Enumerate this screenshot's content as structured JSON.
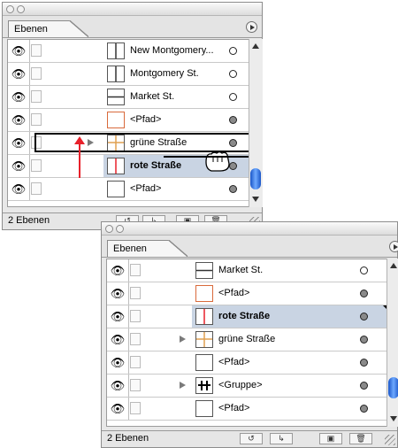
{
  "top_panel": {
    "tab_label": "Ebenen",
    "layers": [
      {
        "name": "New Montgomery...",
        "thumb": "vertical-line",
        "target": "empty",
        "selected": false
      },
      {
        "name": "Montgomery St.",
        "thumb": "vertical-line",
        "target": "empty",
        "selected": false
      },
      {
        "name": "Market St.",
        "thumb": "horizontal-line",
        "target": "empty",
        "selected": false
      },
      {
        "name": "<Pfad>",
        "thumb": "empty-box-orange",
        "target": "filled",
        "selected": false
      },
      {
        "name": "grüne Straße",
        "thumb": "cross-line",
        "target": "filled",
        "selected": false,
        "expandable": true
      },
      {
        "name": "rote Straße",
        "thumb": "red-vertical-line",
        "target": "filled",
        "selected": true
      },
      {
        "name": "<Pfad>",
        "thumb": "empty-box",
        "target": "filled",
        "selected": false
      }
    ],
    "footer": {
      "layer_count": "2 Ebenen"
    }
  },
  "bottom_panel": {
    "tab_label": "Ebenen",
    "layers": [
      {
        "name": "Market St.",
        "thumb": "horizontal-line",
        "target": "empty",
        "selected": false
      },
      {
        "name": "<Pfad>",
        "thumb": "empty-box-orange",
        "target": "filled",
        "selected": false
      },
      {
        "name": "rote Straße",
        "thumb": "red-vertical-line",
        "target": "filled",
        "selected": true
      },
      {
        "name": "grüne Straße",
        "thumb": "cross-line",
        "target": "filled",
        "selected": false,
        "expandable": true
      },
      {
        "name": "<Pfad>",
        "thumb": "empty-box",
        "target": "filled",
        "selected": false
      },
      {
        "name": "<Gruppe>",
        "thumb": "group",
        "target": "filled",
        "selected": false,
        "expandable": true
      },
      {
        "name": "<Pfad>",
        "thumb": "empty-box",
        "target": "filled",
        "selected": false
      }
    ],
    "footer": {
      "layer_count": "2 Ebenen"
    }
  },
  "colors": {
    "selection": "#c9d4e3",
    "drag_arrow": "#e8202a",
    "scroll_thumb": "#2a6de0"
  },
  "icons": {
    "visibility": "eye-icon",
    "menu": "panel-menu-icon",
    "drag_cursor": "hand-cursor-icon",
    "footer": [
      "new-sublayer-icon",
      "new-layer-icon",
      "duplicate-icon",
      "trash-icon"
    ]
  }
}
